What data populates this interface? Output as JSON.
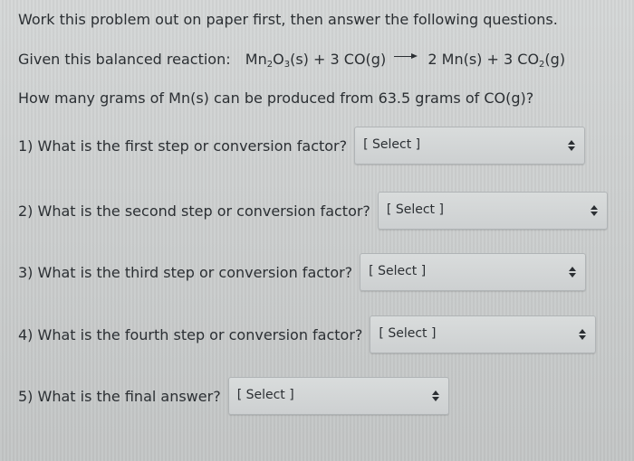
{
  "instructions": "Work this problem out on paper first, then answer the following questions.",
  "reaction": {
    "prefix": "Given this balanced reaction:",
    "reactants": [
      {
        "main": "Mn",
        "sub1": "2",
        "mid": "O",
        "sub2": "3",
        "tail": "(s)"
      },
      {
        "coef": "+ 3",
        "main": "CO(g)"
      }
    ],
    "products": [
      {
        "coef": "2",
        "main": "Mn(s)"
      },
      {
        "coef": "+ 3",
        "main": "CO",
        "sub": "2",
        "tail": "(g)"
      }
    ]
  },
  "problem": "How many grams of Mn(s) can be produced from 63.5 grams of CO(g)?",
  "questions": [
    {
      "text": "1) What is the first step or conversion factor?",
      "select": "[ Select ]"
    },
    {
      "text": "2) What is the second step or conversion factor?",
      "select": "[ Select ]"
    },
    {
      "text": "3) What is the third step or conversion factor?",
      "select": "[ Select ]"
    },
    {
      "text": "4) What is the fourth step or conversion factor?",
      "select": "[ Select ]"
    },
    {
      "text": "5) What is the final answer?",
      "select": "[ Select ]"
    }
  ]
}
